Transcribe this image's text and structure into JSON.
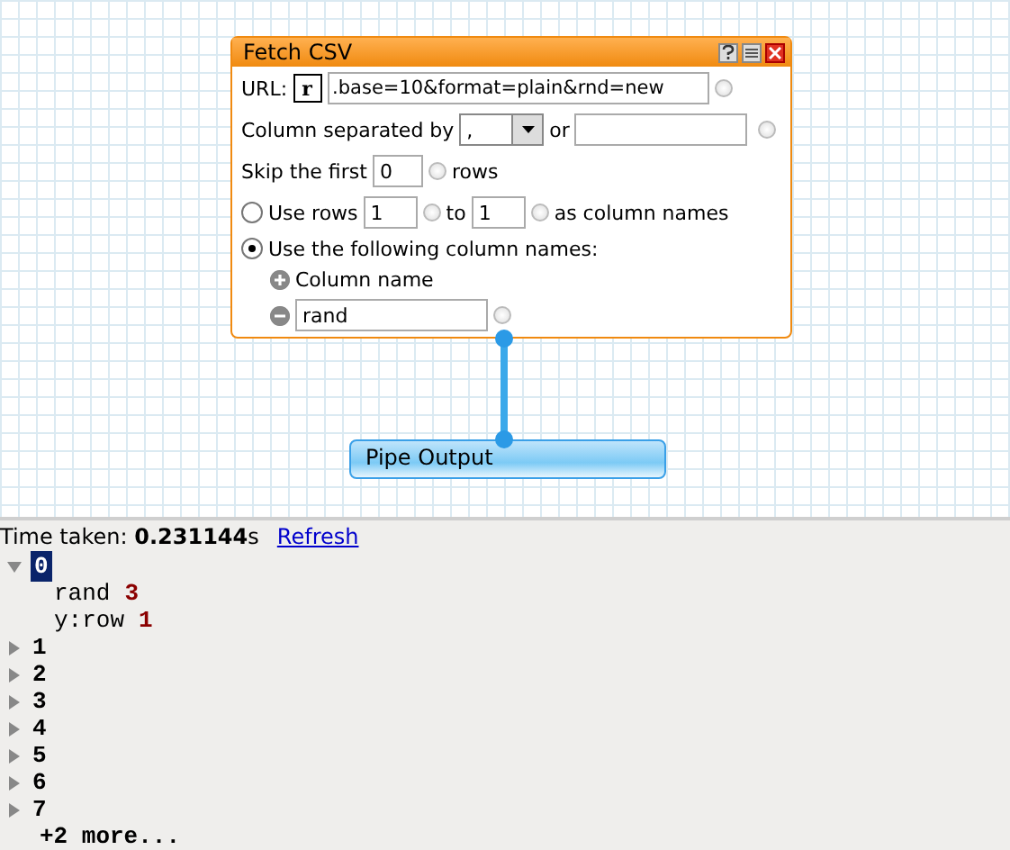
{
  "module": {
    "title": "Fetch CSV",
    "url_label": "URL:",
    "regex_icon": "r",
    "url_value": ".base=10&format=plain&rnd=new",
    "separator_label": "Column separated by",
    "separator_value": ",",
    "or_label": "or",
    "skip_label": "Skip the first",
    "skip_value": "0",
    "rows_label": "rows",
    "column_modes": [
      {
        "kind": "range",
        "label": "Use rows",
        "from": "1",
        "to_label": "to",
        "to": "1",
        "suffix": "as column names",
        "selected": false
      },
      {
        "kind": "names",
        "label": "Use the following column names:",
        "selected": true,
        "add_label": "Column name",
        "names": [
          "rand"
        ]
      }
    ]
  },
  "output_module": {
    "title": "Pipe Output"
  },
  "results": {
    "time_label": "Time taken:",
    "time_value": "0.231144",
    "time_unit": "s",
    "refresh": "Refresh",
    "items": [
      {
        "label": "0",
        "expanded": true,
        "selected": true,
        "fields": [
          {
            "key": "rand",
            "value": "3"
          },
          {
            "key": "y:row",
            "value": "1"
          }
        ]
      },
      {
        "label": "1",
        "expanded": false,
        "selected": false
      },
      {
        "label": "2",
        "expanded": false,
        "selected": false
      },
      {
        "label": "3",
        "expanded": false,
        "selected": false
      },
      {
        "label": "4",
        "expanded": false,
        "selected": false
      },
      {
        "label": "5",
        "expanded": false,
        "selected": false
      },
      {
        "label": "6",
        "expanded": false,
        "selected": false
      },
      {
        "label": "7",
        "expanded": false,
        "selected": false
      }
    ],
    "more": "+2 more..."
  }
}
